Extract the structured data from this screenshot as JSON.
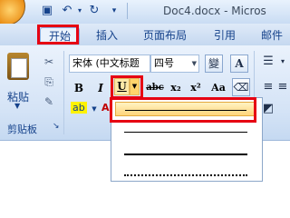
{
  "title_bar": {
    "title": "Doc4.docx - Micros"
  },
  "tabs": [
    {
      "label": "开始",
      "active": true
    },
    {
      "label": "插入"
    },
    {
      "label": "页面布局"
    },
    {
      "label": "引用"
    },
    {
      "label": "邮件"
    }
  ],
  "clipboard": {
    "paste_label": "粘贴",
    "group_label": "剪贴板"
  },
  "font": {
    "font_name": "宋体 (中文标题",
    "font_size": "四号",
    "bold": "B",
    "italic": "I",
    "underline": "U",
    "strikethrough": "abc",
    "subscript": "x₂",
    "superscript": "x²",
    "change_case": "Aa",
    "clear_format": "A",
    "highlight": "ab",
    "font_color": "A"
  },
  "underline_styles": [
    "single-thick-highlighted",
    "single",
    "thick",
    "dotted"
  ],
  "colors": {
    "highlight_red": "#e60012",
    "ribbon_blue": "#15428b",
    "selected_fill": "#ffd57a"
  }
}
